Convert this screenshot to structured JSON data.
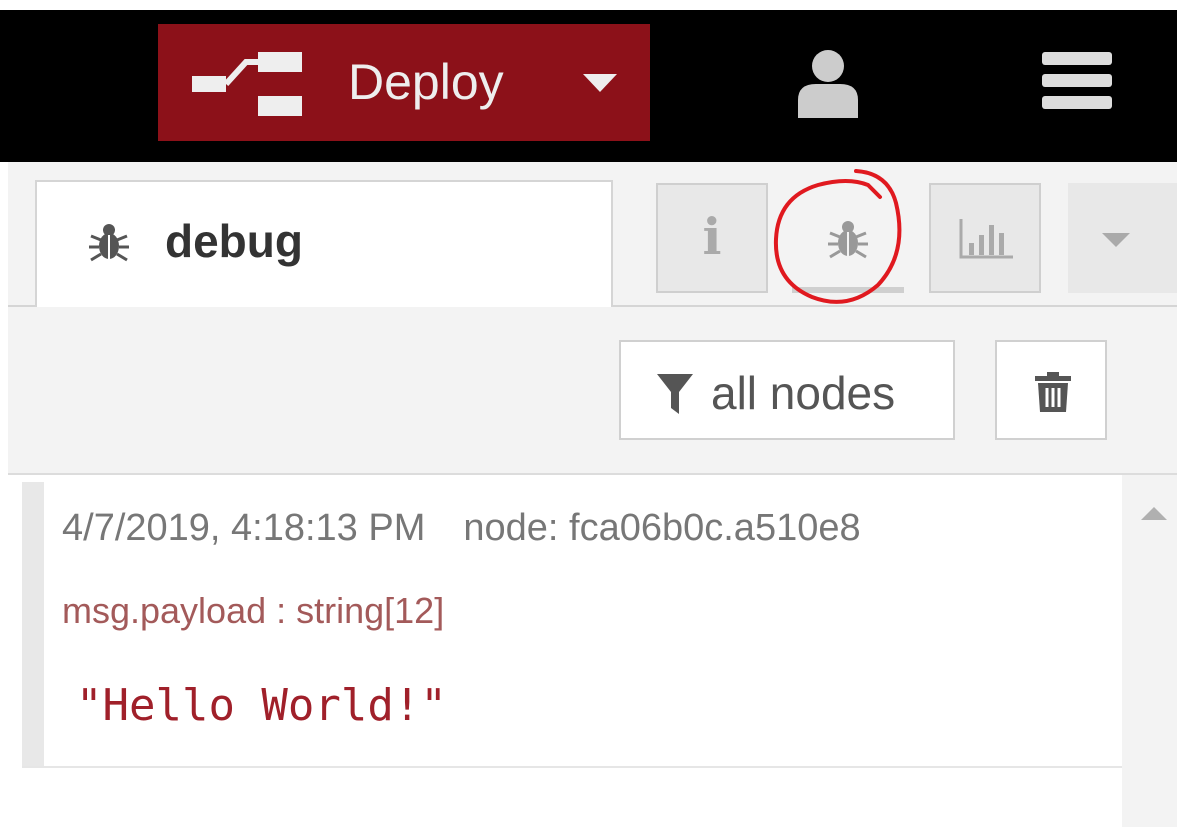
{
  "header": {
    "deploy_label": "Deploy",
    "deploy_icon": "deploy-icon",
    "user_icon": "user-icon",
    "menu_icon": "menu-icon",
    "deploy_color": "#8c1119"
  },
  "sidebar": {
    "active_tab_label": "debug",
    "active_tab_icon": "bug-icon",
    "tab_buttons": [
      {
        "name": "info",
        "glyph": "i",
        "icon": "info-icon"
      },
      {
        "name": "debug",
        "icon": "bug-icon",
        "annotation": "red-hand-drawn-circle"
      },
      {
        "name": "dashboard",
        "icon": "bar-chart-icon"
      }
    ],
    "more_icon": "chevron-down-icon"
  },
  "toolbar": {
    "filter_label": "all nodes",
    "filter_icon": "funnel-icon",
    "clear_icon": "trash-icon"
  },
  "messages": [
    {
      "timestamp": "4/7/2019, 4:18:13 PM",
      "node": "node: fca06b0c.a510e8",
      "topic": "msg.payload : string[12]",
      "value": "\"Hello World!\""
    }
  ]
}
